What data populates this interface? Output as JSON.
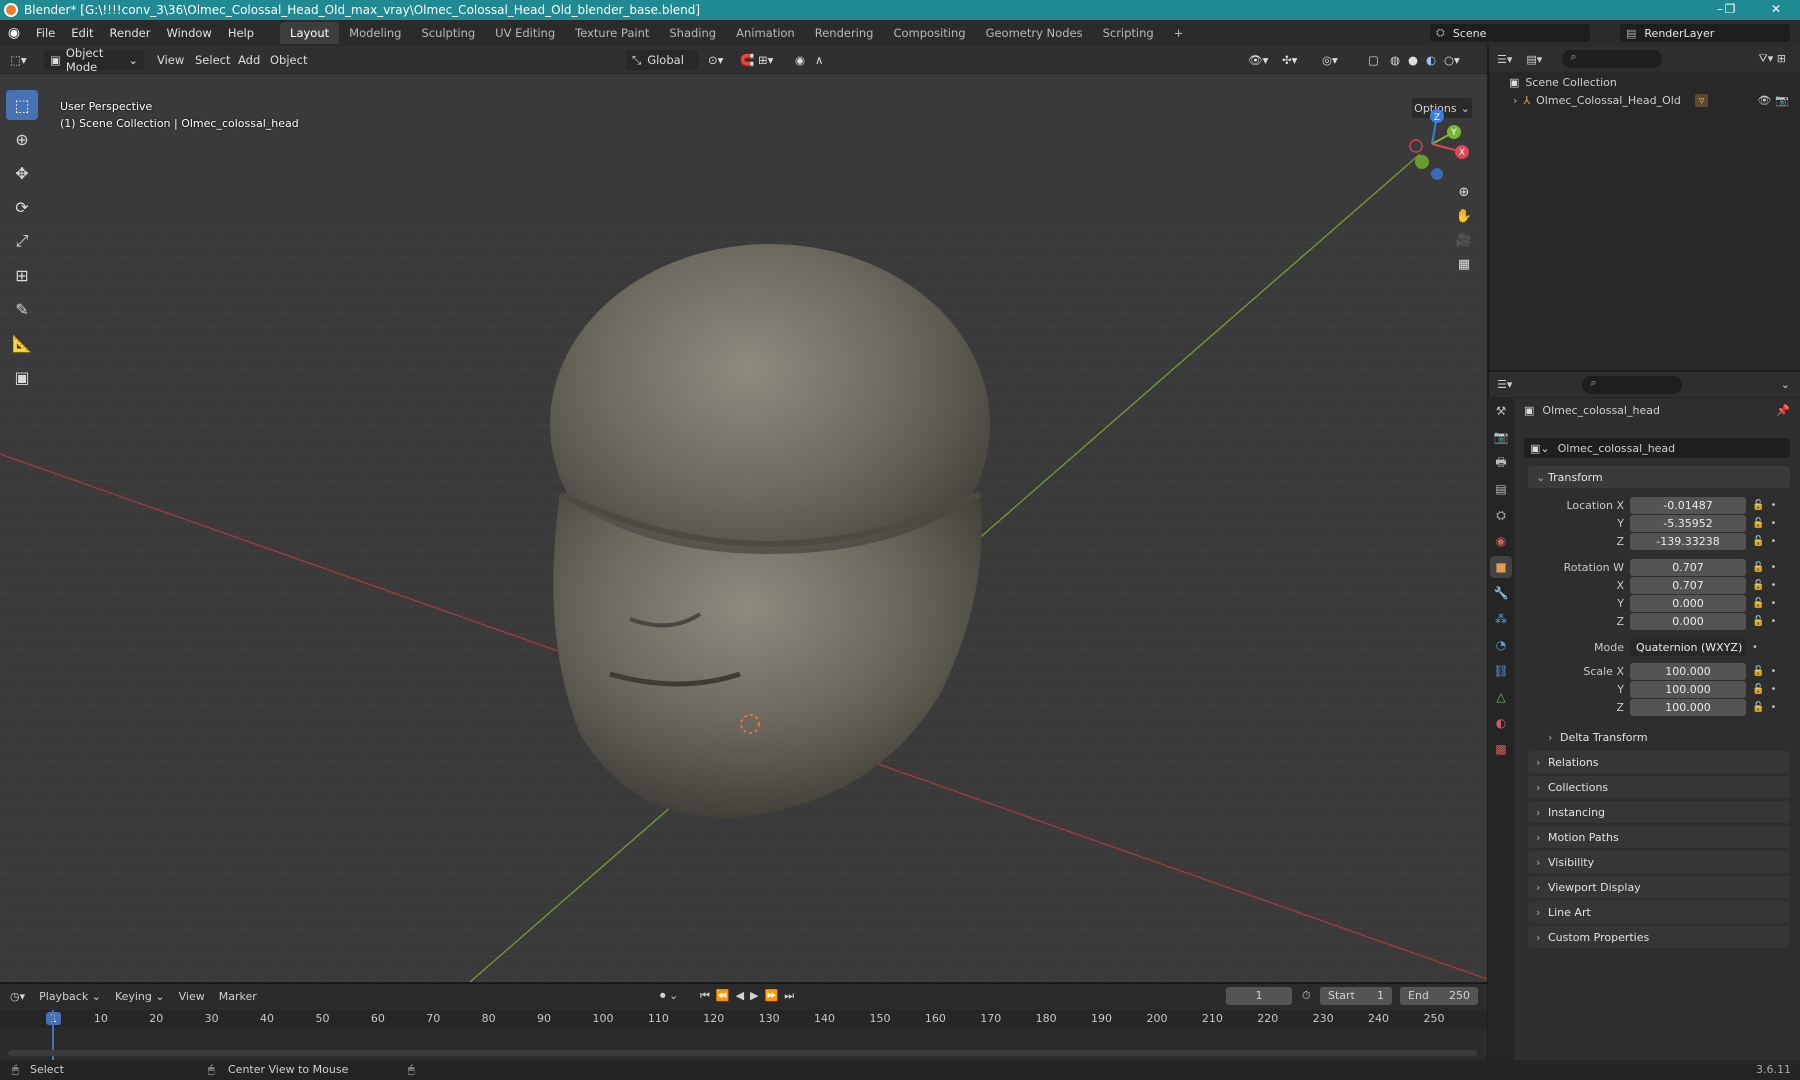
{
  "window": {
    "title": "Blender* [G:\\!!!!conv_3\\36\\Olmec_Colossal_Head_Old_max_vray\\Olmec_Colossal_Head_Old_blender_base.blend]",
    "minimize": "–",
    "maximize": "❐",
    "close": "✕"
  },
  "menu": [
    "File",
    "Edit",
    "Render",
    "Window",
    "Help"
  ],
  "workspaces": [
    "Layout",
    "Modeling",
    "Sculpting",
    "UV Editing",
    "Texture Paint",
    "Shading",
    "Animation",
    "Rendering",
    "Compositing",
    "Geometry Nodes",
    "Scripting"
  ],
  "active_workspace": "Layout",
  "add_workspace": "+",
  "scene_name": "Scene",
  "render_layer": "RenderLayer",
  "viewport_header": {
    "mode": "Object Mode",
    "menus": [
      "View",
      "Select",
      "Add",
      "Object"
    ],
    "orientation": "Global",
    "options": "Options"
  },
  "viewport": {
    "perspective": "User Perspective",
    "collection_info": "(1) Scene Collection | Olmec_colossal_head"
  },
  "gizmo": {
    "z": "Z",
    "y": "Y",
    "x": "X"
  },
  "outliner": {
    "root": "Scene Collection",
    "object": "Olmec_Colossal_Head_Old"
  },
  "properties": {
    "object_name": "Olmec_colossal_head",
    "object_field": "Olmec_colossal_head",
    "transform_title": "Transform",
    "location_x_label": "Location X",
    "location_x": "-0.01487",
    "location_y_label": "Y",
    "location_y": "-5.35952",
    "location_z_label": "Z",
    "location_z": "-139.33238",
    "rotation_w_label": "Rotation W",
    "rotation_w": "0.707",
    "rotation_x_label": "X",
    "rotation_x": "0.707",
    "rotation_y_label": "Y",
    "rotation_y": "0.000",
    "rotation_z_label": "Z",
    "rotation_z": "0.000",
    "mode_label": "Mode",
    "mode": "Quaternion (WXYZ)",
    "scale_x_label": "Scale X",
    "scale_x": "100.000",
    "scale_y_label": "Y",
    "scale_y": "100.000",
    "scale_z_label": "Z",
    "scale_z": "100.000",
    "delta_transform": "Delta Transform",
    "panels": [
      "Relations",
      "Collections",
      "Instancing",
      "Motion Paths",
      "Visibility",
      "Viewport Display",
      "Line Art",
      "Custom Properties"
    ]
  },
  "timeline": {
    "menus": [
      "Playback",
      "Keying",
      "View",
      "Marker"
    ],
    "current_frame": "1",
    "start_label": "Start",
    "start": "1",
    "end_label": "End",
    "end": "250",
    "ruler": [
      "1",
      "10",
      "20",
      "30",
      "40",
      "50",
      "60",
      "70",
      "80",
      "90",
      "100",
      "110",
      "120",
      "130",
      "140",
      "150",
      "160",
      "170",
      "180",
      "190",
      "200",
      "210",
      "220",
      "230",
      "240",
      "250"
    ]
  },
  "status": {
    "left": "Select",
    "middle": "Center View to Mouse",
    "version": "3.6.11"
  }
}
